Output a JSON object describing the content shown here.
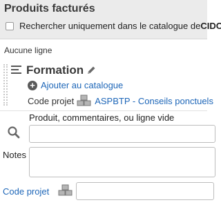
{
  "header": {
    "title": "Produits facturés",
    "cid_search_label_prefix": "Rechercher uniquement dans le catalogue de ",
    "cid_search_label_bold": "CIDO"
  },
  "lines": {
    "empty_text": "Aucune ligne"
  },
  "section": {
    "title": "Formation",
    "add_to_catalog_label": "Ajouter au catalogue",
    "project_code_label": "Code projet",
    "project_code_value": "ASPBTP - Conseils ponctuels"
  },
  "product": {
    "label": "Produit, commentaires, ou ligne vide",
    "input_value": ""
  },
  "notes": {
    "label": "Notes",
    "value": ""
  },
  "footer": {
    "project_code_link": "Code projet",
    "project_code_value": ""
  },
  "icons": {
    "hamburger": "reorder-icon",
    "pencil": "pencil-icon",
    "plus": "plus-circle-icon",
    "boxes": "boxes-icon",
    "search": "search-icon"
  },
  "colors": {
    "header_bg": "#ebebeb",
    "link": "#1d66b8",
    "text": "#333333"
  }
}
